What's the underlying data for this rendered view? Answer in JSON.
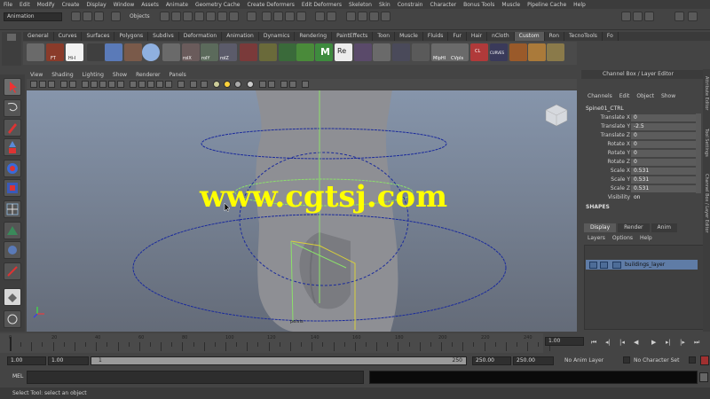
{
  "menubar": {
    "items": [
      "File",
      "Edit",
      "Modify",
      "Create",
      "Display",
      "Window",
      "Assets",
      "Animate",
      "Geometry Cache",
      "Create Deformers",
      "Edit Deformers",
      "Skeleton",
      "Skin",
      "Constrain",
      "Character",
      "Bonus Tools",
      "Muscle",
      "Pipeline Cache",
      "Help"
    ]
  },
  "statusline": {
    "mode": "Animation",
    "objects_label": "Objects"
  },
  "shelf_tabs": {
    "items": [
      "General",
      "Curves",
      "Surfaces",
      "Polygons",
      "Subdivs",
      "Deformation",
      "Animation",
      "Dynamics",
      "Rendering",
      "PaintEffects",
      "Toon",
      "Muscle",
      "Fluids",
      "Fur",
      "Hair",
      "nCloth",
      "Custom",
      "Ron",
      "TecnoTools",
      "Fo"
    ],
    "active": "Custom"
  },
  "shelf": {
    "labels": [
      "FT",
      "Hi-I",
      "rolX",
      "rolY",
      "rolZ",
      "M",
      "Re",
      "MlpHI",
      "CVpls",
      "CL",
      "CURVES"
    ]
  },
  "viewport": {
    "menu": [
      "View",
      "Shading",
      "Lighting",
      "Show",
      "Renderer",
      "Panels"
    ],
    "controller_label": "pelvis",
    "colors": {
      "bg_top": "#8695ab",
      "bg_bottom": "#646b78",
      "curve_blue": "#1a2a9c",
      "selected_green": "#8ce06a",
      "skeleton_yellow": "#d8d03a"
    }
  },
  "channel_box": {
    "title": "Channel Box / Layer Editor",
    "menu": [
      "Channels",
      "Edit",
      "Object",
      "Show"
    ],
    "object": "Spine01_CTRL",
    "channels": [
      {
        "name": "Translate X",
        "value": "0"
      },
      {
        "name": "Translate Y",
        "value": "-2.5"
      },
      {
        "name": "Translate Z",
        "value": "0"
      },
      {
        "name": "Rotate X",
        "value": "0"
      },
      {
        "name": "Rotate Y",
        "value": "0"
      },
      {
        "name": "Rotate Z",
        "value": "0"
      },
      {
        "name": "Scale X",
        "value": "0.531"
      },
      {
        "name": "Scale Y",
        "value": "0.531"
      },
      {
        "name": "Scale Z",
        "value": "0.531"
      },
      {
        "name": "Visibility",
        "value": "on"
      }
    ],
    "shapes_label": "SHAPES"
  },
  "layer_editor": {
    "tabs": [
      "Display",
      "Render",
      "Anim"
    ],
    "active_tab": "Display",
    "menu": [
      "Layers",
      "Options",
      "Help"
    ],
    "layer_name": "buildings_layer"
  },
  "right_tabs": [
    "Attribute Editor",
    "Tool Settings",
    "Channel Box / Layer Editor"
  ],
  "time_slider": {
    "ticks": [
      "0",
      "20",
      "40",
      "60",
      "80",
      "100",
      "120",
      "140",
      "160",
      "180",
      "200",
      "220",
      "240"
    ],
    "current_frame": "1.00"
  },
  "range_slider": {
    "start_time": "1.00",
    "playback_start": "1.00",
    "range_start": "1",
    "range_end": "250",
    "playback_end": "250.00",
    "end_time": "250.00",
    "anim_layer": "No Anim Layer",
    "character_set": "No Character Set"
  },
  "command_line": {
    "label": "MEL"
  },
  "help_line": {
    "text": "Select Tool: select an object"
  },
  "watermark": {
    "text": "www.cgtsj.com"
  }
}
